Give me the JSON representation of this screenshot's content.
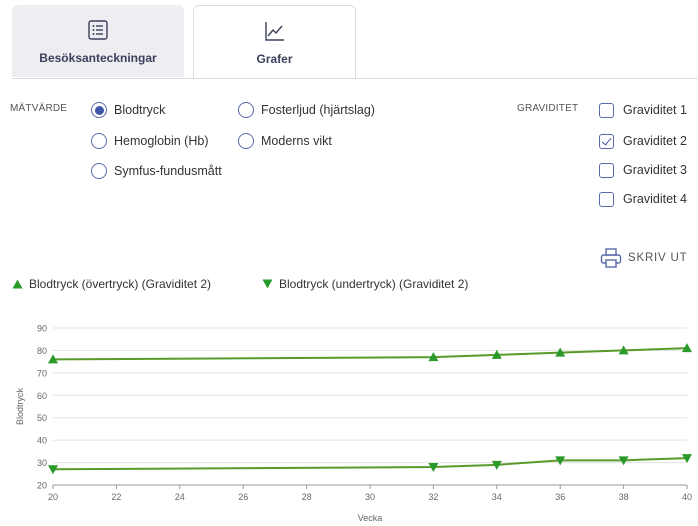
{
  "tabs": [
    {
      "label": "Besöksanteckningar",
      "icon": "list-icon",
      "active": false
    },
    {
      "label": "Grafer",
      "icon": "line-chart-icon",
      "active": true
    }
  ],
  "measure": {
    "label": "MÄTVÄRDE",
    "options": [
      {
        "label": "Blodtryck",
        "selected": true
      },
      {
        "label": "Fosterljud (hjärtslag)",
        "selected": false
      },
      {
        "label": "Hemoglobin (Hb)",
        "selected": false
      },
      {
        "label": "Moderns vikt",
        "selected": false
      },
      {
        "label": "Symfus-fundusmått",
        "selected": false
      }
    ]
  },
  "pregnancy": {
    "label": "GRAVIDITET",
    "options": [
      {
        "label": "Graviditet 1",
        "checked": false
      },
      {
        "label": "Graviditet 2",
        "checked": true
      },
      {
        "label": "Graviditet 3",
        "checked": false
      },
      {
        "label": "Graviditet 4",
        "checked": false
      }
    ]
  },
  "print_label": "SKRIV UT",
  "colors": {
    "series": "#5a9a2a",
    "accent": "#3f57a8",
    "tab_text": "#3a3f5c"
  },
  "chart_data": {
    "type": "line",
    "xlabel": "Vecka",
    "ylabel": "Blodtryck",
    "xlim": [
      20,
      40
    ],
    "ylim": [
      20,
      90
    ],
    "xticks": [
      20,
      22,
      24,
      26,
      28,
      30,
      32,
      34,
      36,
      38,
      40
    ],
    "yticks": [
      20,
      30,
      40,
      50,
      60,
      70,
      80,
      90
    ],
    "grid": "horizontal",
    "legend": "top-left",
    "series": [
      {
        "name": "Blodtryck (övertryck) (Graviditet 2)",
        "marker": "triangle-up",
        "x": [
          20,
          32,
          34,
          36,
          38,
          40
        ],
        "y": [
          76,
          77,
          78,
          79,
          80,
          81
        ]
      },
      {
        "name": "Blodtryck (undertryck) (Graviditet 2)",
        "marker": "triangle-down",
        "x": [
          20,
          32,
          34,
          36,
          38,
          40
        ],
        "y": [
          27,
          28,
          29,
          31,
          31,
          32
        ]
      }
    ]
  }
}
